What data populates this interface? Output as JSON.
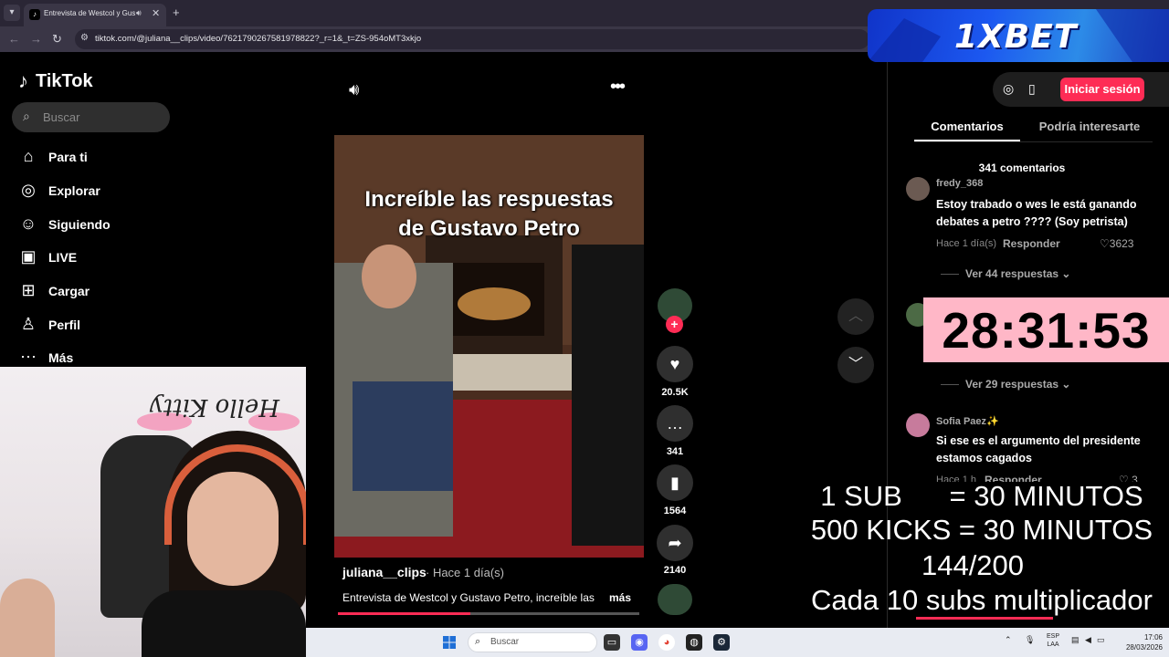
{
  "browser": {
    "tab_title": "Entrevista de Westcol y Gustavo",
    "tab_favicon": "tiktok-icon",
    "url": "tiktok.com/@juliana__clips/video/7621790267581978822?_r=1&_t=ZS-954oMT3xkjo",
    "new_tab": "+"
  },
  "banner": {
    "brand": "1XBET"
  },
  "sidebar": {
    "logo": "TikTok",
    "search_placeholder": "Buscar",
    "items": [
      {
        "label": "Para ti",
        "icon": "home-icon"
      },
      {
        "label": "Explorar",
        "icon": "compass-icon"
      },
      {
        "label": "Siguiendo",
        "icon": "following-icon"
      },
      {
        "label": "LIVE",
        "icon": "live-icon"
      },
      {
        "label": "Cargar",
        "icon": "upload-icon"
      },
      {
        "label": "Perfil",
        "icon": "profile-icon"
      },
      {
        "label": "Más",
        "icon": "more-icon"
      }
    ]
  },
  "video": {
    "overlay_caption_line1": "Increíble las respuestas",
    "overlay_caption_line2": "de Gustavo Petro",
    "author": "juliana__clips",
    "posted": "· Hace 1 día(s)",
    "description": "Entrevista de Westcol y Gustavo Petro, increíble las",
    "more_label": "más",
    "progress": 0.44
  },
  "actions": {
    "likes": "20.5K",
    "comments": "341",
    "saves": "1564",
    "shares": "2140"
  },
  "right_panel": {
    "login_label": "Iniciar sesión",
    "tab_comments": "Comentarios",
    "tab_related": "Podría interesarte",
    "comment_count": "341 comentarios",
    "comments": [
      {
        "user": "fredy_368",
        "text": "Estoy trabado o wes le está ganando debates a petro ???? (Soy petrista)",
        "time": "Hace 1 día(s)",
        "reply_label": "Responder",
        "likes": "3623",
        "view_replies": "Ver 44 respuestas"
      },
      {
        "view_replies": "Ver 29 respuestas"
      },
      {
        "user": "Sofia Paez✨",
        "text": "Si ese es el argumento del presidente estamos cagados",
        "time": "Hace 1 h",
        "reply_label": "Responder",
        "likes": "3"
      }
    ]
  },
  "stream_overlay": {
    "timer": "28:31:53",
    "line1": "1 SUB      = 30 MINUTOS",
    "line2": "500 KICKS = 30 MINUTOS",
    "line3": "144/200",
    "line4": "Cada 10 subs multiplicador",
    "webcam_decor_text": "Hello Kitty"
  },
  "taskbar": {
    "search_placeholder": "Buscar",
    "lang_top": "ESP",
    "lang_bottom": "LAA",
    "time": "17:06",
    "date": "28/03/2026"
  },
  "colors": {
    "accent": "#fe2c55",
    "timer_bg": "#ffb7c7",
    "banner": "#1c58f0"
  }
}
